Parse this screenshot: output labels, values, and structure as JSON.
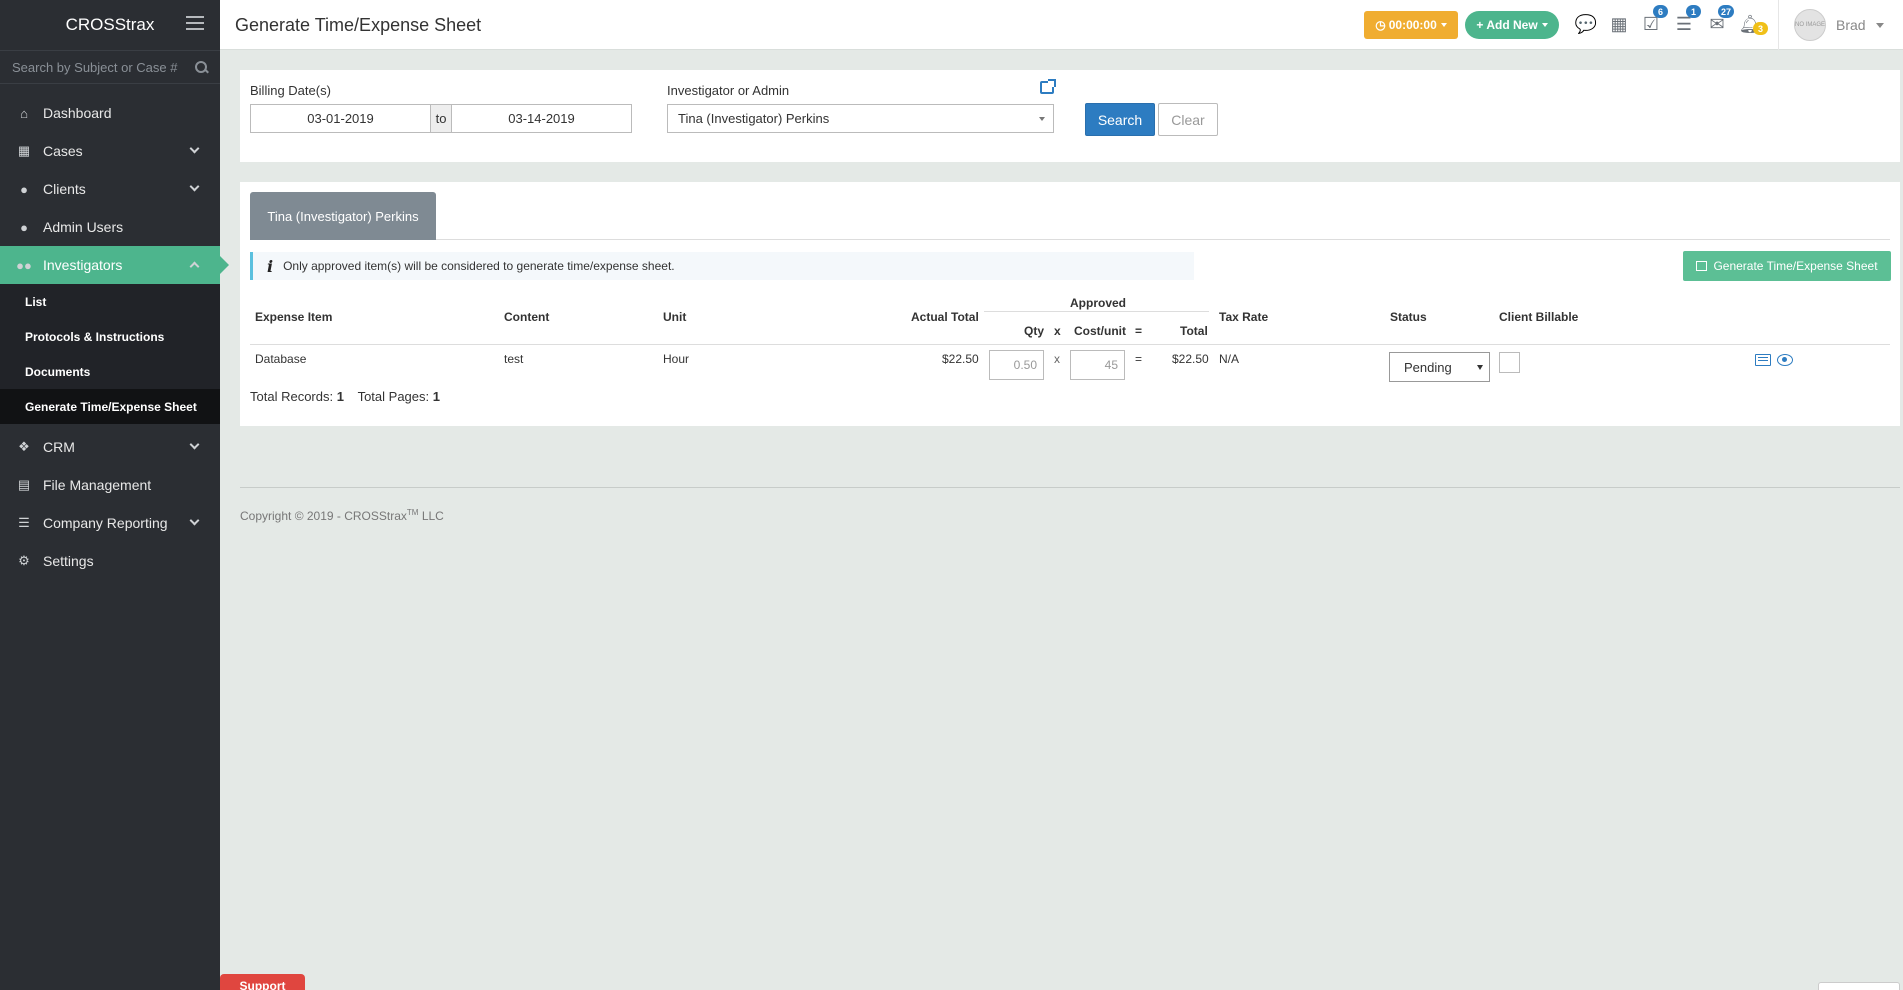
{
  "app": {
    "brand": "CROSStrax"
  },
  "search": {
    "placeholder": "Search by Subject or Case #"
  },
  "sidebar": {
    "items": [
      {
        "label": "Dashboard",
        "icon": "home-icon"
      },
      {
        "label": "Cases",
        "icon": "grid-icon"
      },
      {
        "label": "Clients",
        "icon": "user-icon"
      },
      {
        "label": "Admin Users",
        "icon": "user-icon"
      },
      {
        "label": "Investigators",
        "icon": "users-icon"
      },
      {
        "label": "CRM",
        "icon": "cubes-icon"
      },
      {
        "label": "File Management",
        "icon": "file-icon"
      },
      {
        "label": "Company Reporting",
        "icon": "list-icon"
      },
      {
        "label": "Settings",
        "icon": "gear-icon"
      }
    ],
    "investigators_sub": [
      "List",
      "Protocols & Instructions",
      "Documents",
      "Generate Time/Expense Sheet"
    ]
  },
  "header": {
    "title": "Generate Time/Expense Sheet",
    "timer": "00:00:00",
    "add_new": "Add New",
    "badges": {
      "tasks": "6",
      "list": "1",
      "mail": "27",
      "bell": "3"
    },
    "user_name": "Brad",
    "avatar_text": "NO IMAGE"
  },
  "filters": {
    "billing_label": "Billing Date(s)",
    "date_from": "03-01-2019",
    "to_label": "to",
    "date_to": "03-14-2019",
    "investigator_label": "Investigator or Admin",
    "investigator_value": "Tina (Investigator) Perkins",
    "search_button": "Search",
    "clear_button": "Clear"
  },
  "results": {
    "tab": "Tina (Investigator) Perkins",
    "info": "Only approved item(s) will be considered to generate time/expense sheet.",
    "generate_button": "Generate Time/Expense Sheet",
    "headers": {
      "expense_item": "Expense Item",
      "content": "Content",
      "unit": "Unit",
      "actual_total": "Actual Total",
      "approved": "Approved",
      "qty": "Qty",
      "x": "x",
      "cost_unit": "Cost/unit",
      "eq": "=",
      "total": "Total",
      "tax_rate": "Tax Rate",
      "status": "Status",
      "client_billable": "Client Billable"
    },
    "rows": [
      {
        "expense_item": "Database",
        "content": "test",
        "unit": "Hour",
        "actual_total": "$22.50",
        "qty": "0.50",
        "x": "x",
        "cost_unit": "45",
        "eq": "=",
        "total": "$22.50",
        "tax_rate": "N/A",
        "status": "Pending"
      }
    ],
    "total_records_label": "Total Records:",
    "total_records": "1",
    "total_pages_label": "Total Pages:",
    "total_pages": "1"
  },
  "footer": {
    "copyright": "Copyright © 2019 - CROSStrax",
    "tm": "TM",
    "llc": "LLC"
  },
  "support": "Support"
}
